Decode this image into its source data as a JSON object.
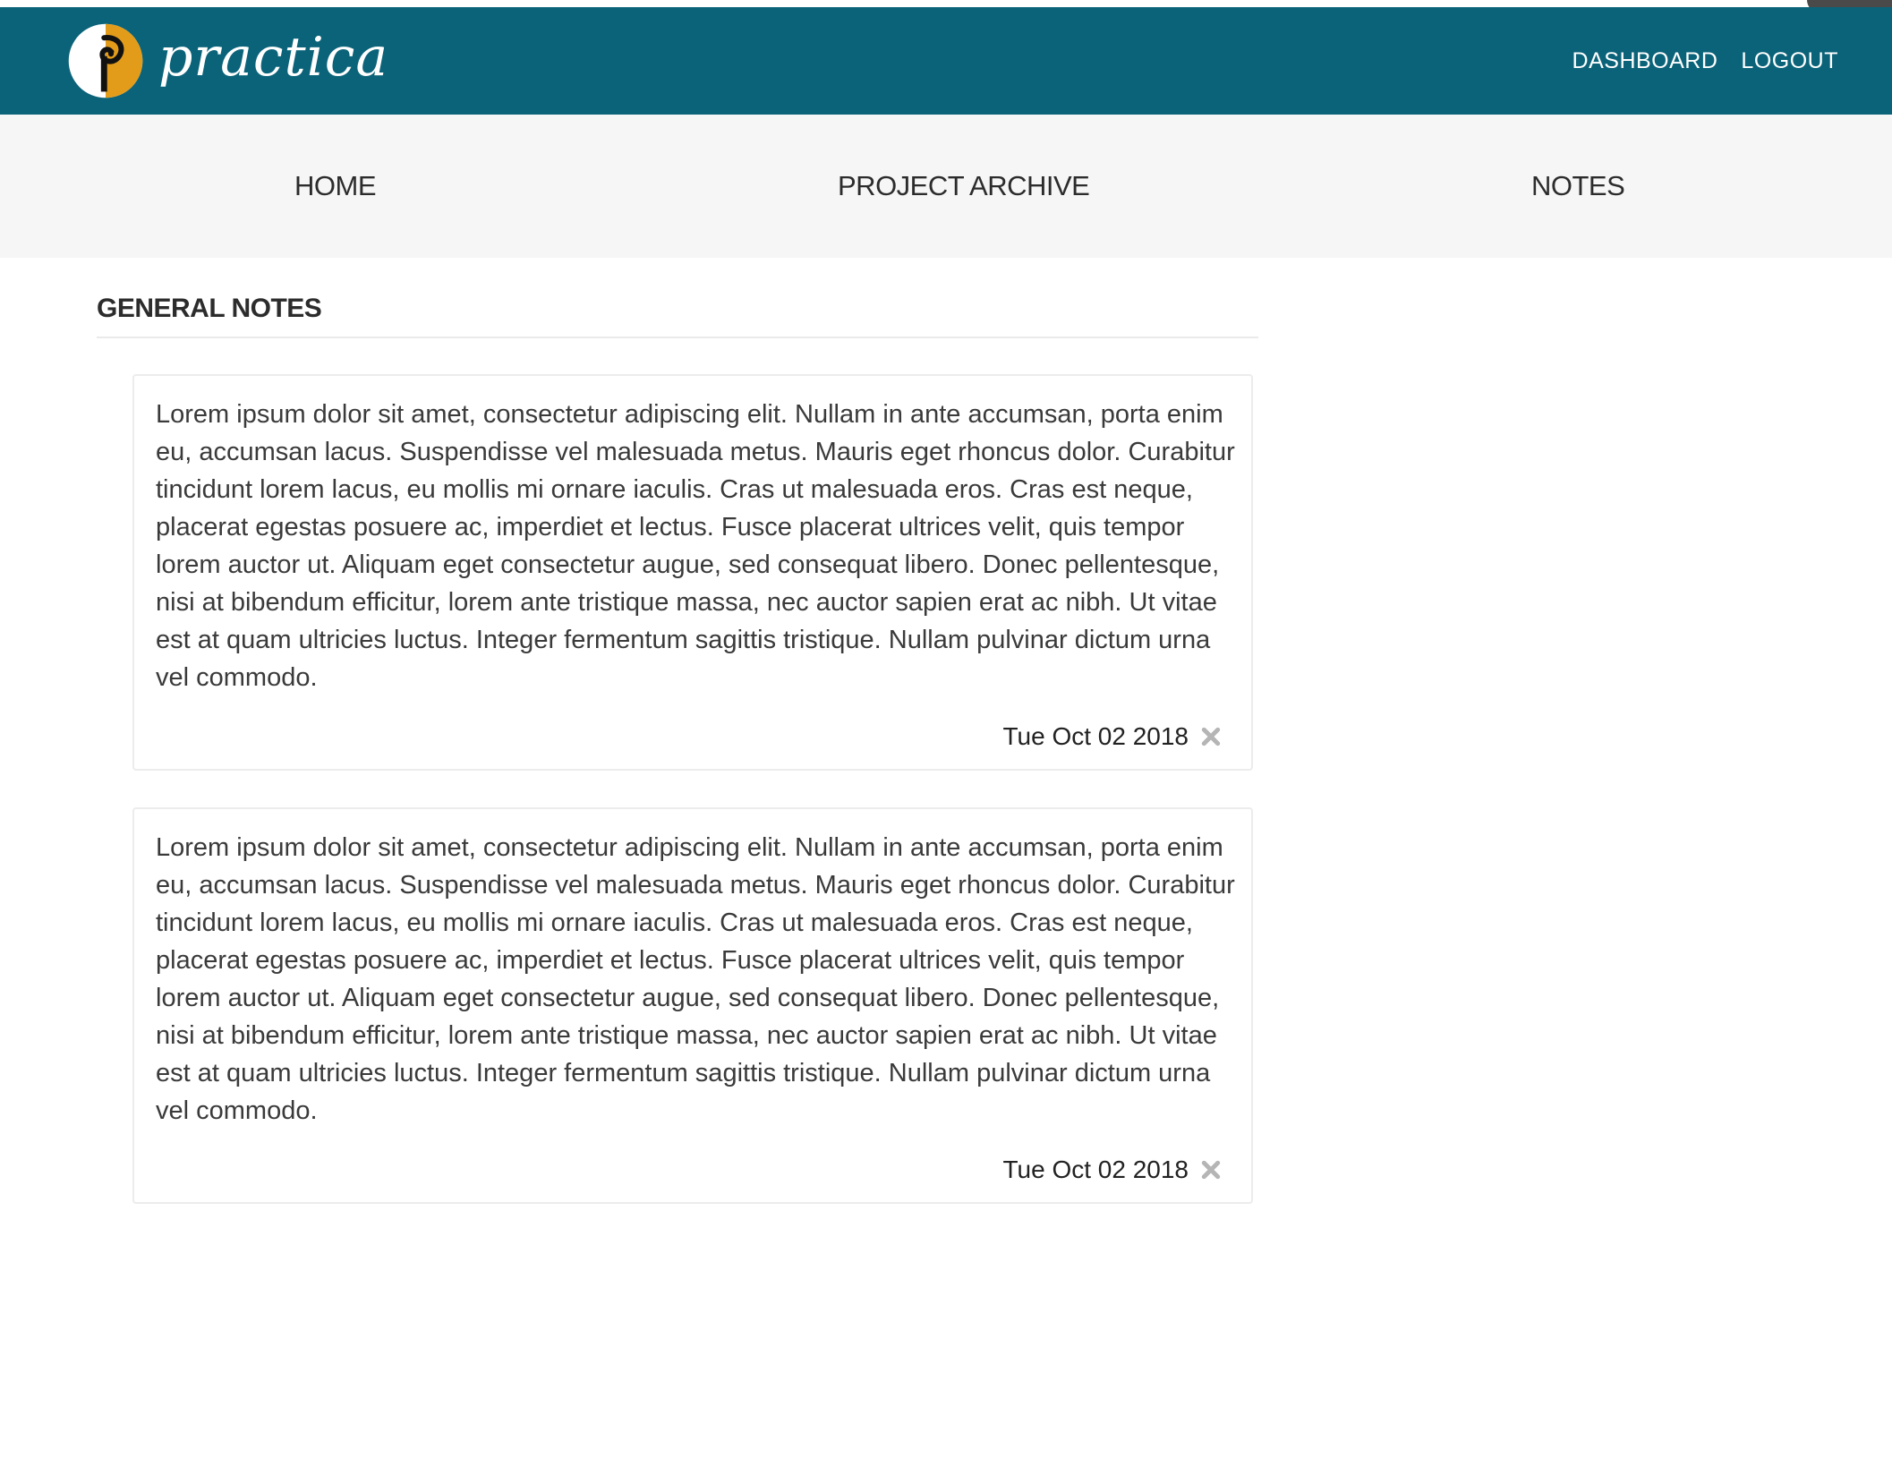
{
  "header": {
    "brand": "practica",
    "links": {
      "dashboard": "DASHBOARD",
      "logout": "LOGOUT"
    }
  },
  "subnav": {
    "home": "HOME",
    "project_archive": "PROJECT ARCHIVE",
    "notes": "NOTES"
  },
  "main": {
    "section_title": "GENERAL NOTES",
    "notes": [
      {
        "text": "Lorem ipsum dolor sit amet, consectetur adipiscing elit. Nullam in ante accumsan, porta enim eu, accumsan lacus. Suspendisse vel malesuada metus. Mauris eget rhoncus dolor. Curabitur tincidunt lorem lacus, eu mollis mi ornare iaculis. Cras ut malesuada eros. Cras est neque, placerat egestas posuere ac, imperdiet et lectus. Fusce placerat ultrices velit, quis tempor lorem auctor ut. Aliquam eget consectetur augue, sed consequat libero. Donec pellentesque, nisi at bibendum efficitur, lorem ante tristique massa, nec auctor sapien erat ac nibh. Ut vitae est at quam ultricies luctus. Integer fermentum sagittis tristique. Nullam pulvinar dictum urna vel commodo.",
        "date": "Tue Oct 02 2018",
        "delete_icon": "close-icon"
      },
      {
        "text": "Lorem ipsum dolor sit amet, consectetur adipiscing elit. Nullam in ante accumsan, porta enim eu, accumsan lacus. Suspendisse vel malesuada metus. Mauris eget rhoncus dolor. Curabitur tincidunt lorem lacus, eu mollis mi ornare iaculis. Cras ut malesuada eros. Cras est neque, placerat egestas posuere ac, imperdiet et lectus. Fusce placerat ultrices velit, quis tempor lorem auctor ut. Aliquam eget consectetur augue, sed consequat libero. Donec pellentesque, nisi at bibendum efficitur, lorem ante tristique massa, nec auctor sapien erat ac nibh. Ut vitae est at quam ultricies luctus. Integer fermentum sagittis tristique. Nullam pulvinar dictum urna vel commodo.",
        "date": "Tue Oct 02 2018",
        "delete_icon": "close-icon"
      }
    ]
  },
  "colors": {
    "header_bg": "#0b6379",
    "subnav_bg": "#f6f6f6",
    "logo_accent": "#e39c1a",
    "delete_icon": "#b5b5b5"
  }
}
